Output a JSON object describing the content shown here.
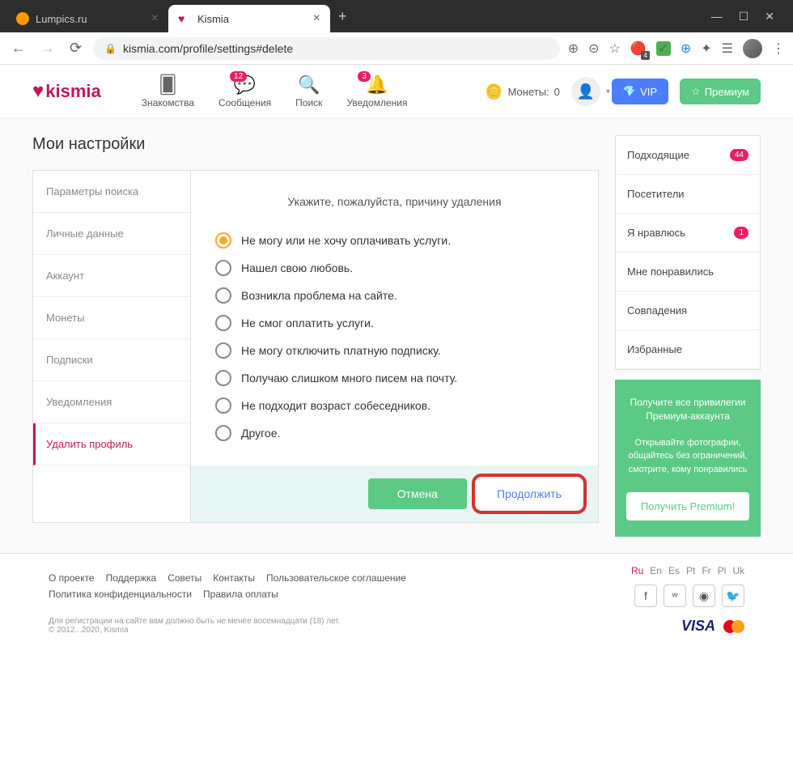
{
  "browser": {
    "tabs": [
      {
        "title": "Lumpics.ru"
      },
      {
        "title": "Kismia"
      }
    ],
    "url": "kismia.com/profile/settings#delete",
    "ext_badge": "4"
  },
  "header": {
    "logo": "kismia",
    "nav": [
      {
        "label": "Знакомства",
        "badge": ""
      },
      {
        "label": "Сообщения",
        "badge": "12"
      },
      {
        "label": "Поиск",
        "badge": ""
      },
      {
        "label": "Уведомления",
        "badge": "3"
      }
    ],
    "coins_label": "Монеты:",
    "coins_value": "0",
    "vip": "VIP",
    "premium": "Премиум"
  },
  "page": {
    "title": "Мои настройки",
    "sidebar": [
      "Параметры поиска",
      "Личные данные",
      "Аккаунт",
      "Монеты",
      "Подписки",
      "Уведомления",
      "Удалить профиль"
    ],
    "form_title": "Укажите, пожалуйста, причину удаления",
    "options": [
      "Не могу или не хочу оплачивать услуги.",
      "Нашел свою любовь.",
      "Возникла проблема на сайте.",
      "Не смог оплатить услуги.",
      "Не могу отключить платную подписку.",
      "Получаю слишком много писем на почту.",
      "Не подходит возраст собеседников.",
      "Другое."
    ],
    "cancel": "Отмена",
    "continue": "Продолжить"
  },
  "right": {
    "items": [
      {
        "label": "Подходящие",
        "badge": "44"
      },
      {
        "label": "Посетители",
        "badge": ""
      },
      {
        "label": "Я нравлюсь",
        "badge": "1"
      },
      {
        "label": "Мне понравились",
        "badge": ""
      },
      {
        "label": "Совпадения",
        "badge": ""
      },
      {
        "label": "Избранные",
        "badge": ""
      }
    ],
    "promo_title": "Получите все привилегии Премиум-аккаунта",
    "promo_text": "Открывайте фотографии, общайтесь без ограничений, смотрите, кому понравились",
    "promo_btn": "Получить Premium!"
  },
  "footer": {
    "links": [
      "О проекте",
      "Поддержка",
      "Советы",
      "Контакты",
      "Пользовательское соглашение",
      "Политика конфиденциальности",
      "Правила оплаты"
    ],
    "langs": [
      "Ru",
      "En",
      "Es",
      "Pt",
      "Fr",
      "Pl",
      "Uk"
    ],
    "disclaimer": "Для регистрации на сайте вам должно быть не менее восемнадцати (18) лет.",
    "copyright": "© 2012...2020, Kismia",
    "visa": "VISA"
  }
}
